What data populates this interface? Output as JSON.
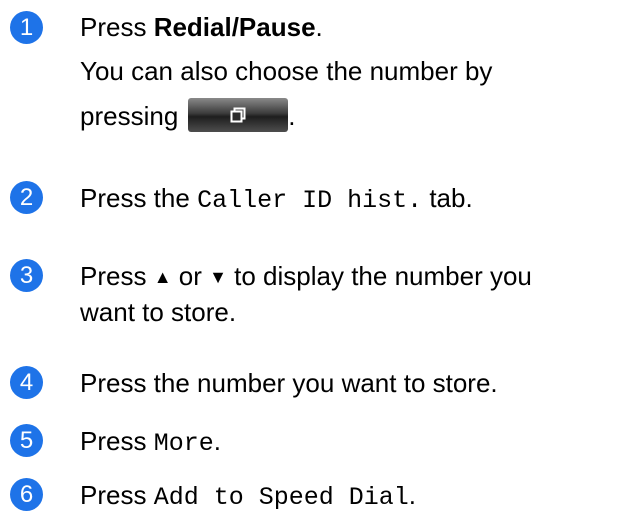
{
  "steps": [
    {
      "number": "1",
      "line1_prefix": "Press ",
      "line1_bold": "Redial/Pause",
      "line1_suffix": ".",
      "line2": "You can also choose the number by",
      "line3_text": "pressing",
      "line3_suffix": ".",
      "button_icon": "history-window-icon"
    },
    {
      "number": "2",
      "prefix": "Press the ",
      "mono": "Caller ID hist.",
      "suffix": " tab."
    },
    {
      "number": "3",
      "line1_prefix": "Press ",
      "up_symbol": "▲",
      "middle": " or ",
      "down_symbol": "▼",
      "line1_suffix": " to display the number you",
      "line2": "want to store."
    },
    {
      "number": "4",
      "text": "Press the number you want to store."
    },
    {
      "number": "5",
      "prefix": "Press ",
      "mono": "More",
      "suffix": "."
    },
    {
      "number": "6",
      "prefix": "Press ",
      "mono": "Add to Speed Dial",
      "suffix": "."
    }
  ],
  "colors": {
    "badge": "#1e73e8"
  }
}
